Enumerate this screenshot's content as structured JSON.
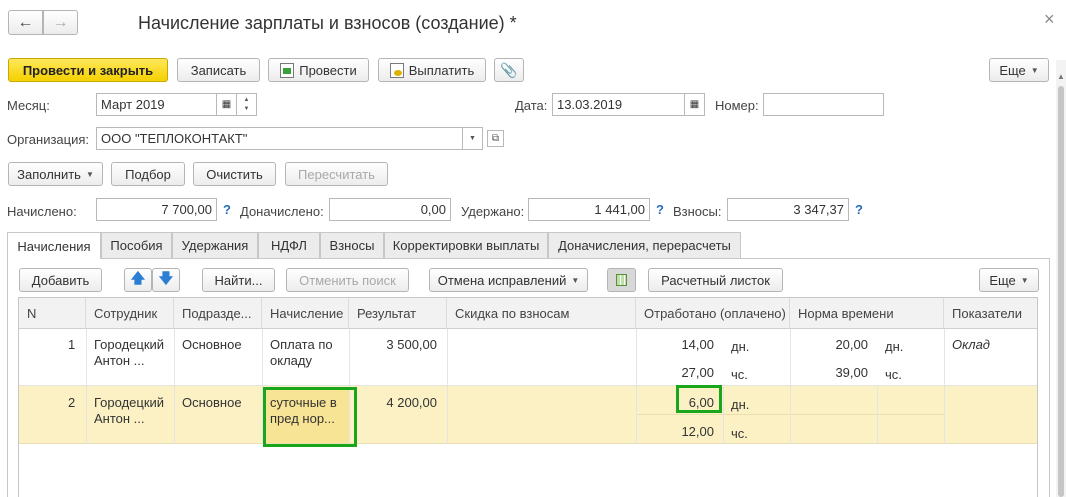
{
  "window": {
    "title": "Начисление зарплаты и взносов (создание) *",
    "back_label": "←",
    "forward_label": "→",
    "close_label": "×"
  },
  "toolbar": {
    "post_close": "Провести и закрыть",
    "save": "Записать",
    "post": "Провести",
    "pay": "Выплатить",
    "more": "Еще"
  },
  "header": {
    "month_label": "Месяц:",
    "month_value": "Март 2019",
    "date_label": "Дата:",
    "date_value": "13.03.2019",
    "number_label": "Номер:",
    "number_value": "",
    "org_label": "Организация:",
    "org_value": "ООО \"ТЕПЛОКОНТАКТ\""
  },
  "actions": {
    "fill": "Заполнить",
    "pick": "Подбор",
    "clear": "Очистить",
    "recalc": "Пересчитать"
  },
  "totals": {
    "accrued_label": "Начислено:",
    "accrued_value": "7 700,00",
    "extra_label": "Доначислено:",
    "extra_value": "0,00",
    "withheld_label": "Удержано:",
    "withheld_value": "1 441,00",
    "contrib_label": "Взносы:",
    "contrib_value": "3 347,37",
    "help": "?"
  },
  "tabs": [
    "Начисления",
    "Пособия",
    "Удержания",
    "НДФЛ",
    "Взносы",
    "Корректировки выплаты",
    "Доначисления, перерасчеты"
  ],
  "table_toolbar": {
    "add": "Добавить",
    "find": "Найти...",
    "cancel_search": "Отменить поиск",
    "cancel_corrections": "Отмена исправлений",
    "payslip": "Расчетный листок",
    "more": "Еще"
  },
  "table": {
    "columns": [
      "N",
      "Сотрудник",
      "Подразде...",
      "Начисление",
      "Результат",
      "Скидка по взносам",
      "Отработано (оплачено)",
      "Норма времени",
      "Показатели"
    ],
    "rows": [
      {
        "n": "1",
        "employee_line1": "Городецкий",
        "employee_line2": "Антон ...",
        "department": "Основное",
        "accrual_line1": "Оплата по",
        "accrual_line2": "окладу",
        "result": "3 500,00",
        "worked_days": "14,00",
        "days_unit": "дн.",
        "worked_hours": "27,00",
        "hours_unit": "чс.",
        "norm_days": "20,00",
        "norm_days_unit": "дн.",
        "norm_hours": "39,00",
        "norm_hours_unit": "чс.",
        "indicators": "Оклад"
      },
      {
        "n": "2",
        "employee_line1": "Городецкий",
        "employee_line2": "Антон ...",
        "department": "Основное",
        "accrual_line1": "суточные в",
        "accrual_line2": "пред нор...",
        "result": "4 200,00",
        "worked_days": "6,00",
        "days_unit": "дн.",
        "worked_hours": "12,00",
        "hours_unit": "чс."
      }
    ]
  },
  "colors": {
    "primary_button": "#f5d000",
    "selected_row": "#fbf1c4",
    "highlight_box": "#1aa61a",
    "help_blue": "#2a6ebb"
  }
}
